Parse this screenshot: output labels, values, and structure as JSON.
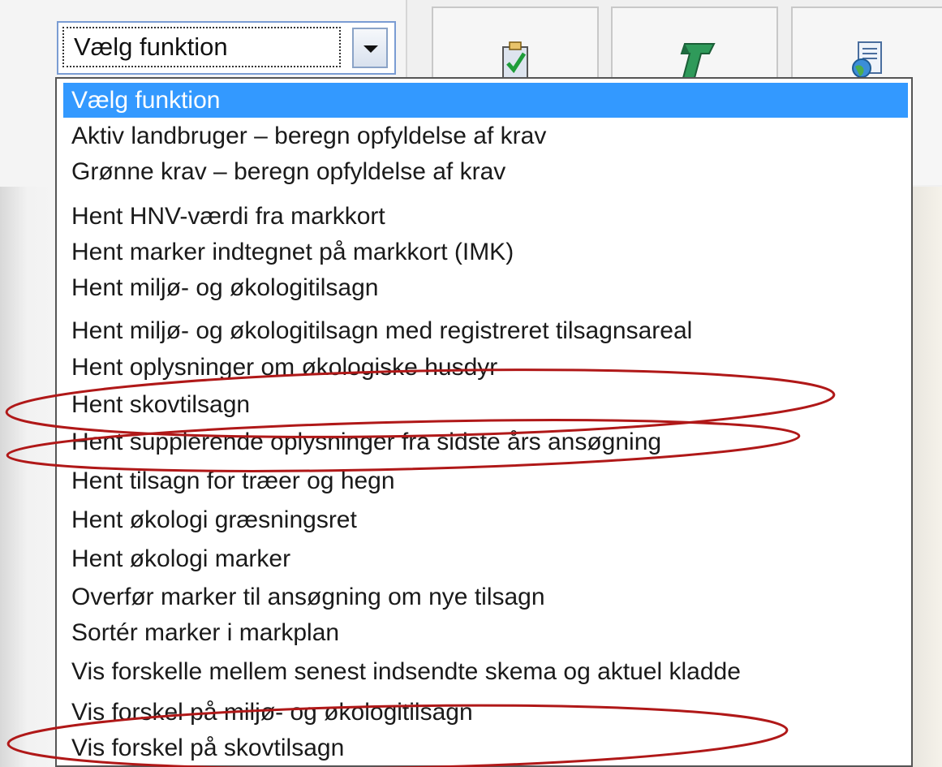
{
  "select": {
    "value": "Vælg funktion"
  },
  "toolbar": {
    "buttons": [
      {
        "icon": "clipboard-check-icon"
      },
      {
        "icon": "green-t-icon"
      },
      {
        "icon": "document-globe-icon"
      }
    ]
  },
  "dropdown": {
    "selected_index": 0,
    "options": [
      "Vælg funktion",
      "Aktiv landbruger – beregn opfyldelse af krav",
      "Grønne krav – beregn opfyldelse af krav",
      "Hent HNV-værdi fra markkort",
      "Hent marker indtegnet på markkort (IMK)",
      "Hent miljø- og økologitilsagn",
      "Hent miljø- og økologitilsagn med registreret tilsagnsareal",
      "Hent oplysninger om økologiske husdyr",
      "Hent skovtilsagn",
      "Hent supplerende oplysninger fra sidste års ansøgning",
      "Hent tilsagn for træer og hegn",
      "Hent økologi græsningsret",
      "Hent økologi marker",
      "Overfør marker til ansøgning om nye tilsagn",
      "Sortér marker i markplan",
      "Vis forskelle mellem senest indsendte skema og aktuel kladde",
      "Vis forskel på miljø- og økologitilsagn",
      "Vis forskel på skovtilsagn"
    ]
  },
  "annotations": {
    "highlight_color": "#b01818",
    "highlighted_options": [
      "Hent skovtilsagn",
      "Hent supplerende oplysninger fra sidste års ansøgning",
      "Vis forskel på skovtilsagn"
    ]
  }
}
